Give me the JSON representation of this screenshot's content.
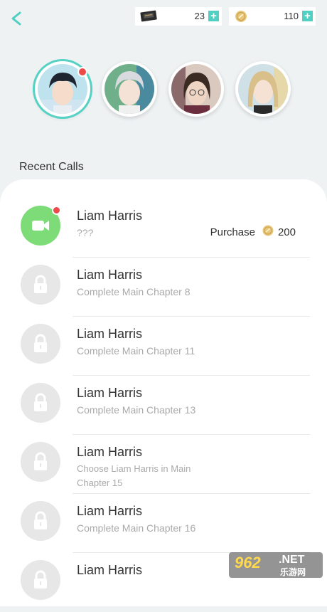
{
  "header": {
    "tickets_amount": "23",
    "coins_amount": "110",
    "plus_symbol": "+"
  },
  "avatars": [
    {
      "name": "avatar-1",
      "selected": true,
      "has_notification": true
    },
    {
      "name": "avatar-2",
      "selected": false,
      "has_notification": false
    },
    {
      "name": "avatar-3",
      "selected": false,
      "has_notification": false
    },
    {
      "name": "avatar-4",
      "selected": false,
      "has_notification": false
    }
  ],
  "section_title": "Recent Calls",
  "calls": [
    {
      "name": "Liam Harris",
      "subtitle": "???",
      "status": "available",
      "icon": "video-camera-icon",
      "purchase_label": "Purchase",
      "purchase_price": "200"
    },
    {
      "name": "Liam Harris",
      "subtitle": "Complete Main Chapter 8",
      "status": "locked",
      "icon": "lock-icon"
    },
    {
      "name": "Liam Harris",
      "subtitle": "Complete Main Chapter 11",
      "status": "locked",
      "icon": "lock-icon"
    },
    {
      "name": "Liam Harris",
      "subtitle": "Complete Main Chapter 13",
      "status": "locked",
      "icon": "lock-icon"
    },
    {
      "name": "Liam Harris",
      "subtitle": "Choose Liam Harris in Main Chapter 15",
      "status": "locked",
      "icon": "lock-icon"
    },
    {
      "name": "Liam Harris",
      "subtitle": "Complete Main Chapter 16",
      "status": "locked",
      "icon": "lock-icon"
    },
    {
      "name": "Liam Harris",
      "subtitle": "",
      "status": "locked",
      "icon": "lock-icon"
    }
  ],
  "watermark": {
    "brand": "962",
    "net": ".NET",
    "cn": "乐游网"
  },
  "colors": {
    "accent": "#4fd0c2",
    "call_green": "#7ddc77",
    "notify_red": "#ee4a4a",
    "locked_grey": "#e7e7e7"
  }
}
